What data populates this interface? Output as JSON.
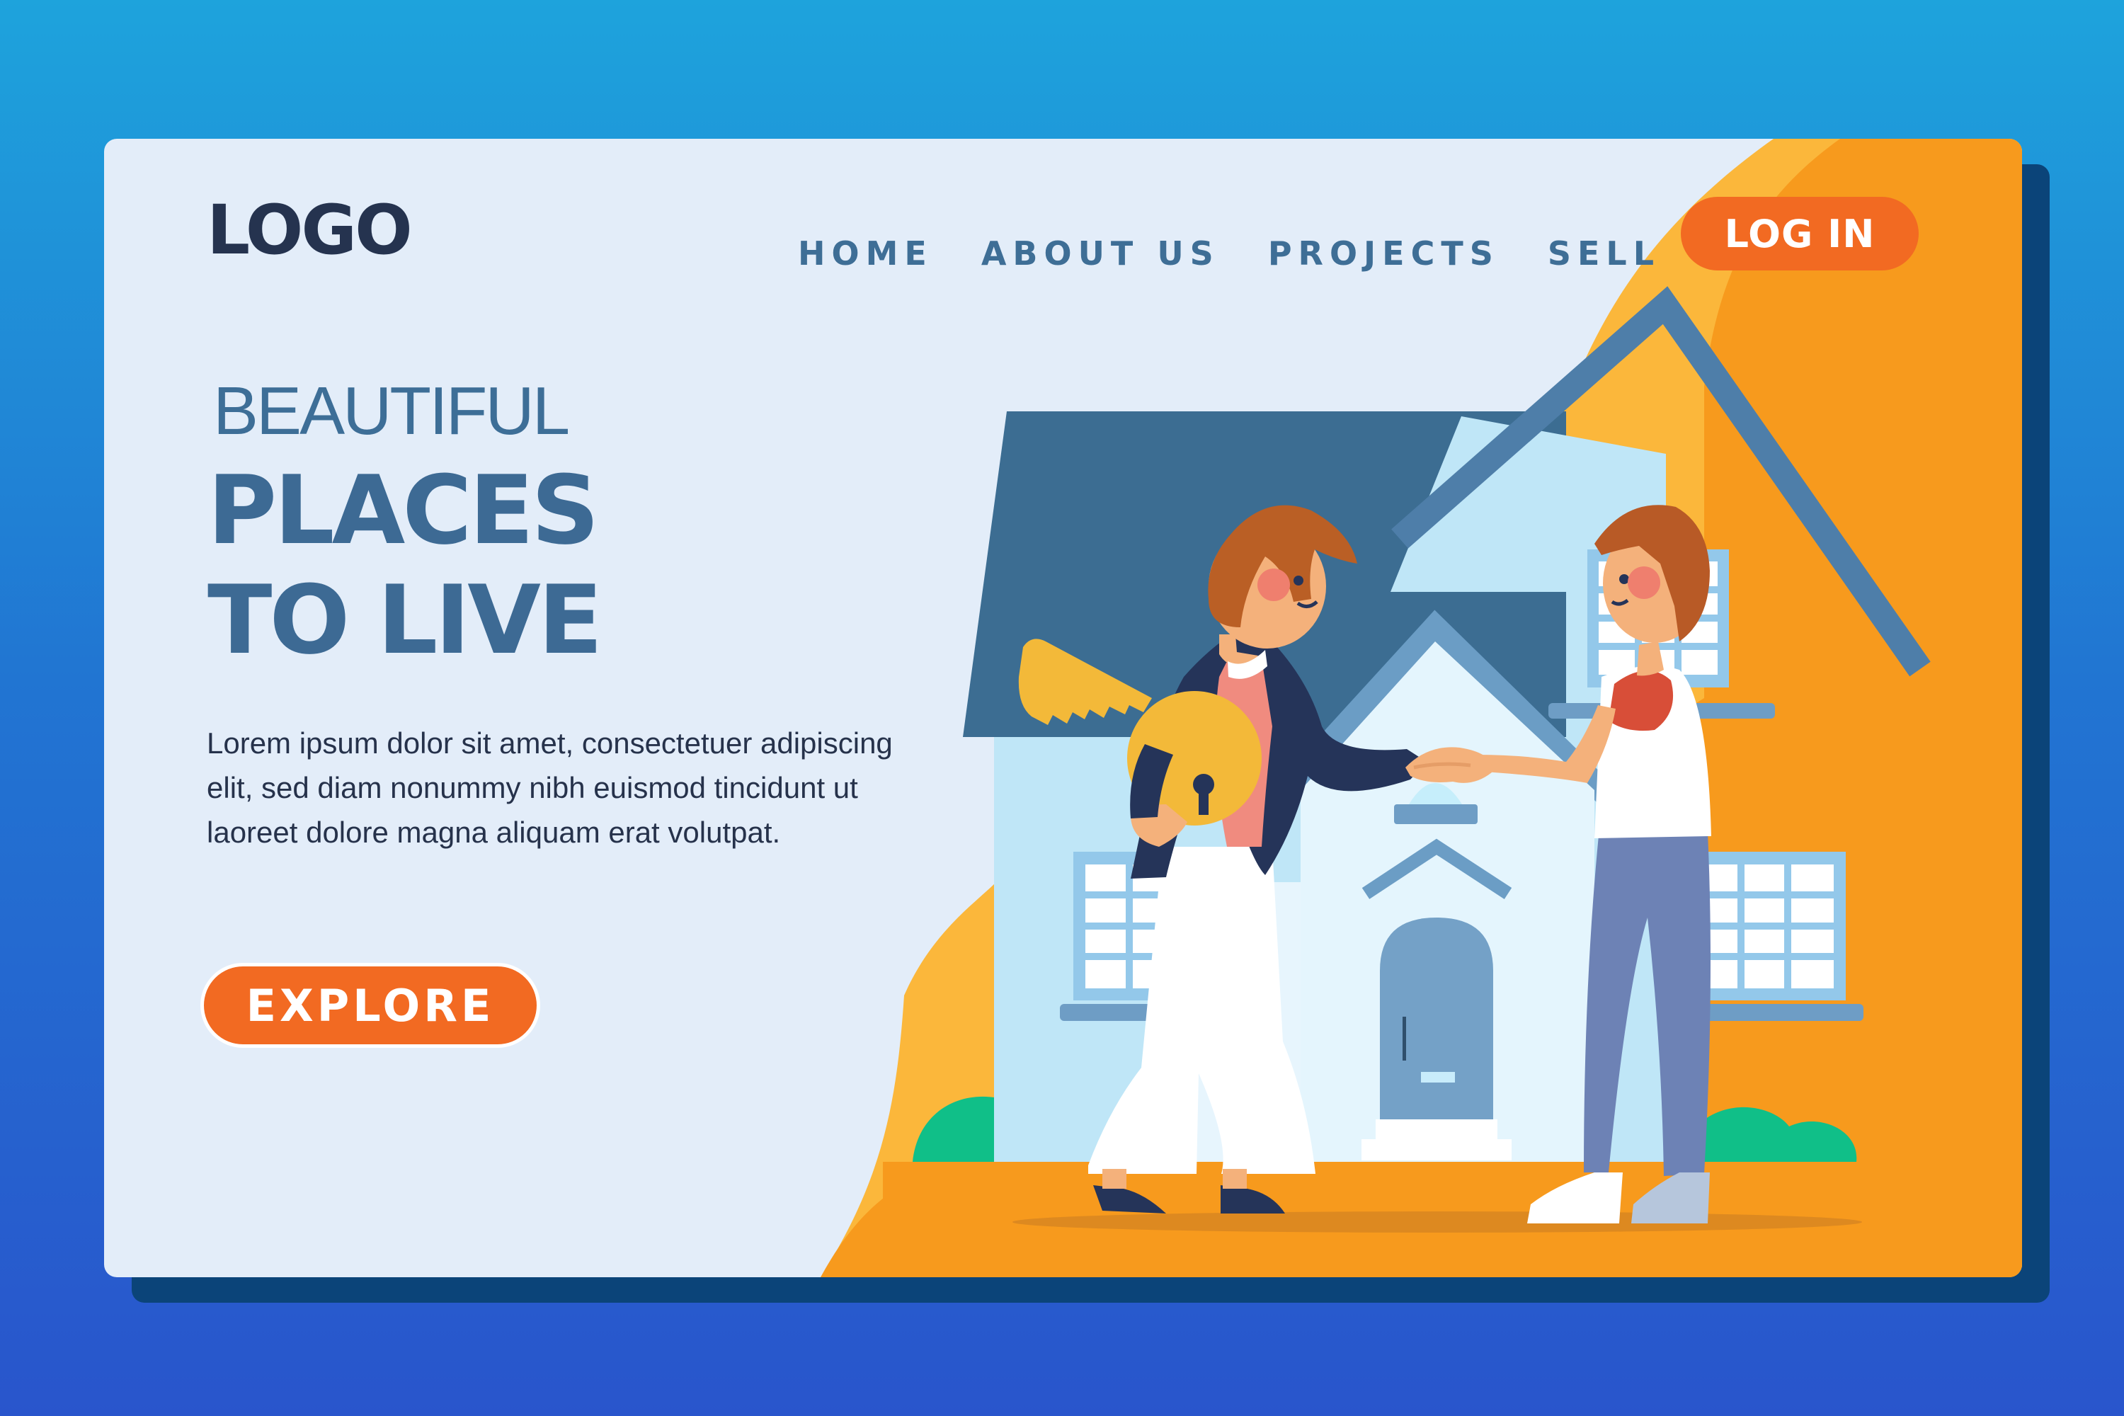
{
  "header": {
    "logo_text": "LOGO",
    "nav": [
      "HOME",
      "ABOUT US",
      "PROJECTS",
      "SELL"
    ],
    "login_label": "LOG IN"
  },
  "hero": {
    "overline": "BEAUTIFUL",
    "title_line_1": "PLACES",
    "title_line_2": "TO LIVE",
    "body": "Lorem ipsum dolor sit amet, consectetuer adipiscing elit, sed diam nonummy nibh euismod tincidunt ut laoreet dolore magna aliquam erat volutpat.",
    "cta_label": "EXPLORE"
  },
  "colors": {
    "page_background_top": "#1ea3dc",
    "page_background_bottom": "#2955cc",
    "card_background": "#e3edf9",
    "brand_orange": "#f26a22",
    "accent_orange": "#f79a1d",
    "accent_yellow": "#fbb73b",
    "heading_blue": "#3d6a94",
    "logo_navy": "#25334f"
  },
  "illustration": {
    "scene": "real-estate-handshake",
    "icons": [
      "house-illustration",
      "key-icon",
      "woman-agent-figure",
      "man-buyer-figure",
      "handshake-icon",
      "bush-icon"
    ]
  }
}
